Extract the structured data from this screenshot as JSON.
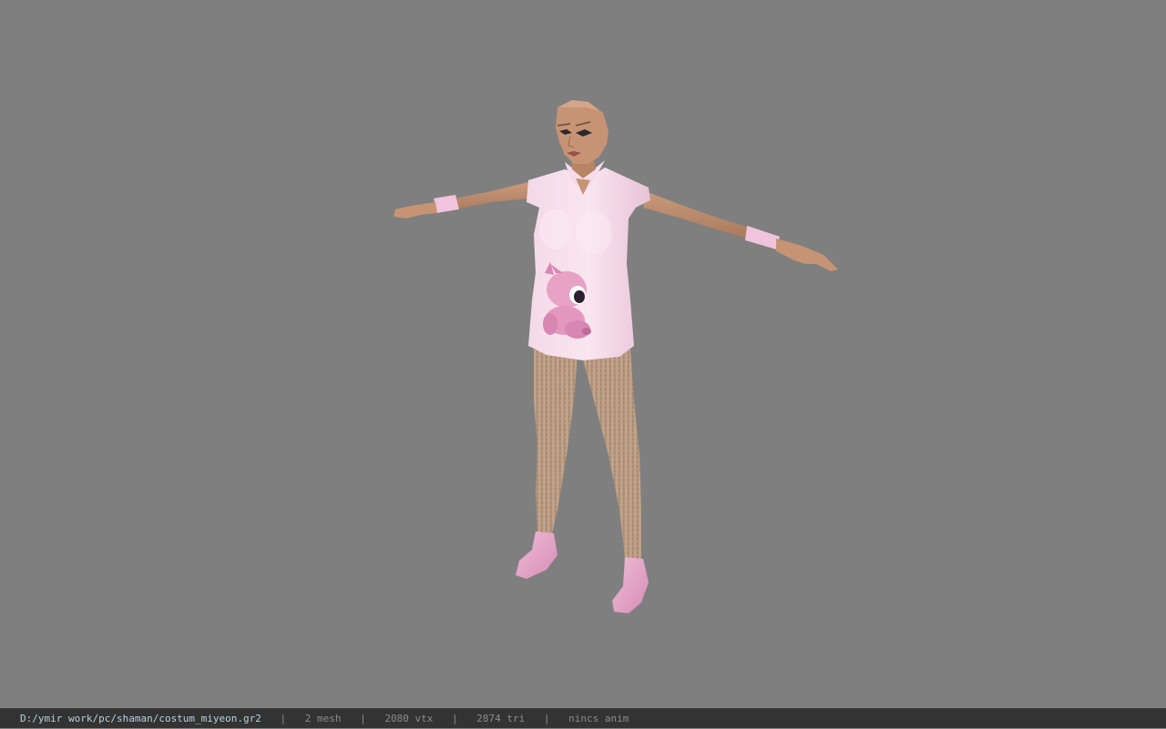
{
  "viewer": {
    "background_color": "#7f7f7f",
    "model_description": "female character in pink outfit, T-pose"
  },
  "status_bar": {
    "file_path": "D:/ymir work/pc/shaman/costum_miyeon.gr2",
    "separator": "|",
    "mesh_count": "2 mesh",
    "vertex_count": "2080 vtx",
    "triangle_count": "2874 tri",
    "animation": "nincs anim",
    "background_color": "#333333",
    "path_color": "#b8d2e0",
    "stat_color": "#8c8c8c"
  }
}
